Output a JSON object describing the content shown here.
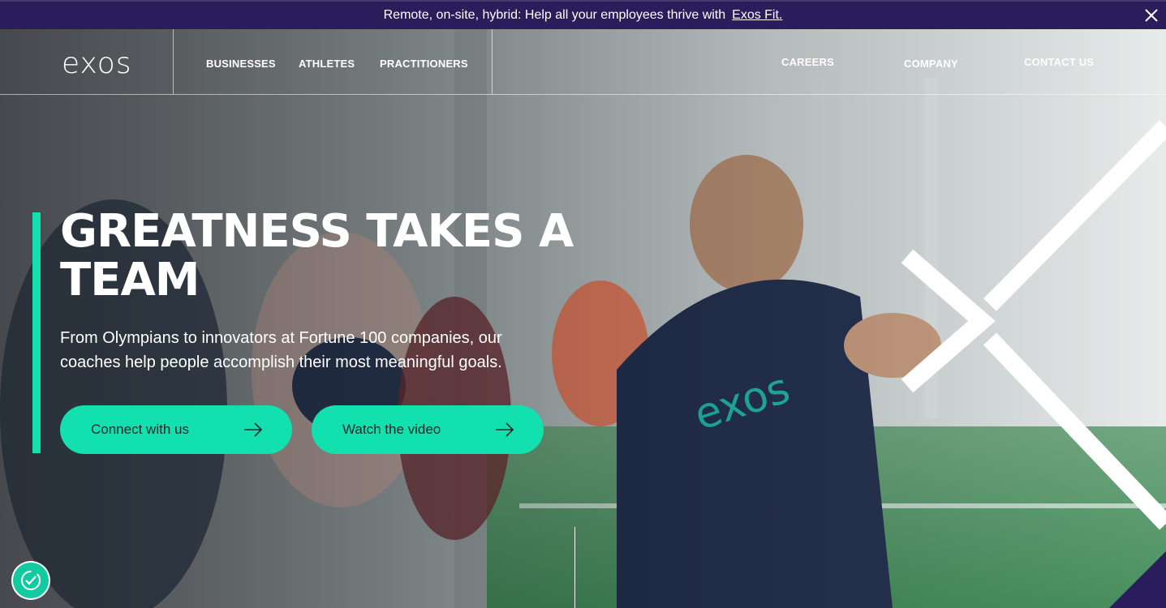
{
  "banner": {
    "text": "Remote, on-site, hybrid: Help all your employees thrive with",
    "link": "Exos Fit."
  },
  "brand": {
    "logo": "exos",
    "shirt_logo": "exos"
  },
  "nav": {
    "left": [
      "BUSINESSES",
      "ATHLETES",
      "PRACTITIONERS"
    ],
    "right": [
      "CAREERS",
      "COMPANY",
      "CONTACT US"
    ]
  },
  "hero": {
    "headline": "GREATNESS TAKES A TEAM",
    "subtext": "From Olympians to innovators at Fortune 100 companies, our coaches help people accomplish their most meaningful goals.",
    "cta_primary": "Connect with us",
    "cta_secondary": "Watch the video"
  },
  "icons": {
    "close": "close-icon",
    "arrow": "arrow-right-icon",
    "accessibility": "accessibility-icon"
  },
  "colors": {
    "accent": "#12e0ae",
    "banner_bg": "#2a1d5c",
    "corner": "#2a1d5c"
  }
}
